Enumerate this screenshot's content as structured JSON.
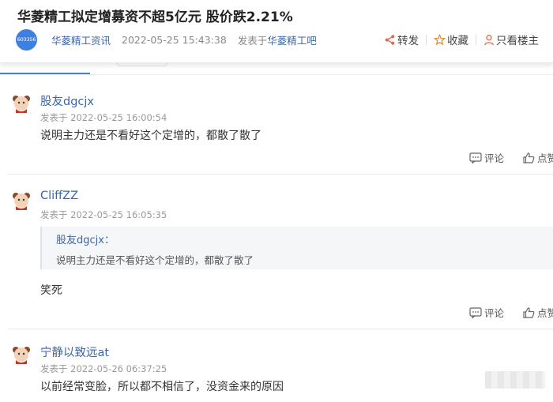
{
  "post": {
    "title": "华菱精工拟定增募资不超5亿元 股价跌2.21%",
    "stock_code": "603356",
    "author": "华菱精工资讯",
    "time": "2022-05-25 15:43:38",
    "posted_in_prefix": "发表于",
    "posted_in_bar": "华菱精工吧"
  },
  "actions": {
    "share": "转发",
    "favorite": "收藏",
    "only_author": "只看楼主"
  },
  "comments": [
    {
      "user": "股友dgcjx",
      "time": "发表于 2022-05-25 16:00:54",
      "text": "说明主力还是不看好这个定增的，都散了散了",
      "comment_label": "评论",
      "like_label": "点赞"
    },
    {
      "user": "CliffZZ",
      "time": "发表于 2022-05-25 16:05:35",
      "quote_user": "股友dgcjx：",
      "quote_text": "说明主力还是不看好这个定增的，都散了散了",
      "text": "笑死",
      "comment_label": "评论",
      "like_label": "点赞"
    },
    {
      "user": "宁静以致远at",
      "time": "发表于 2022-05-26 06:37:25",
      "text": "以前经常变脸，所以都不相信了，没资金来的原因"
    }
  ],
  "colors": {
    "link": "#3966a8",
    "accent": "#3f7fe0",
    "avatar_bg": "#fbeee6"
  }
}
